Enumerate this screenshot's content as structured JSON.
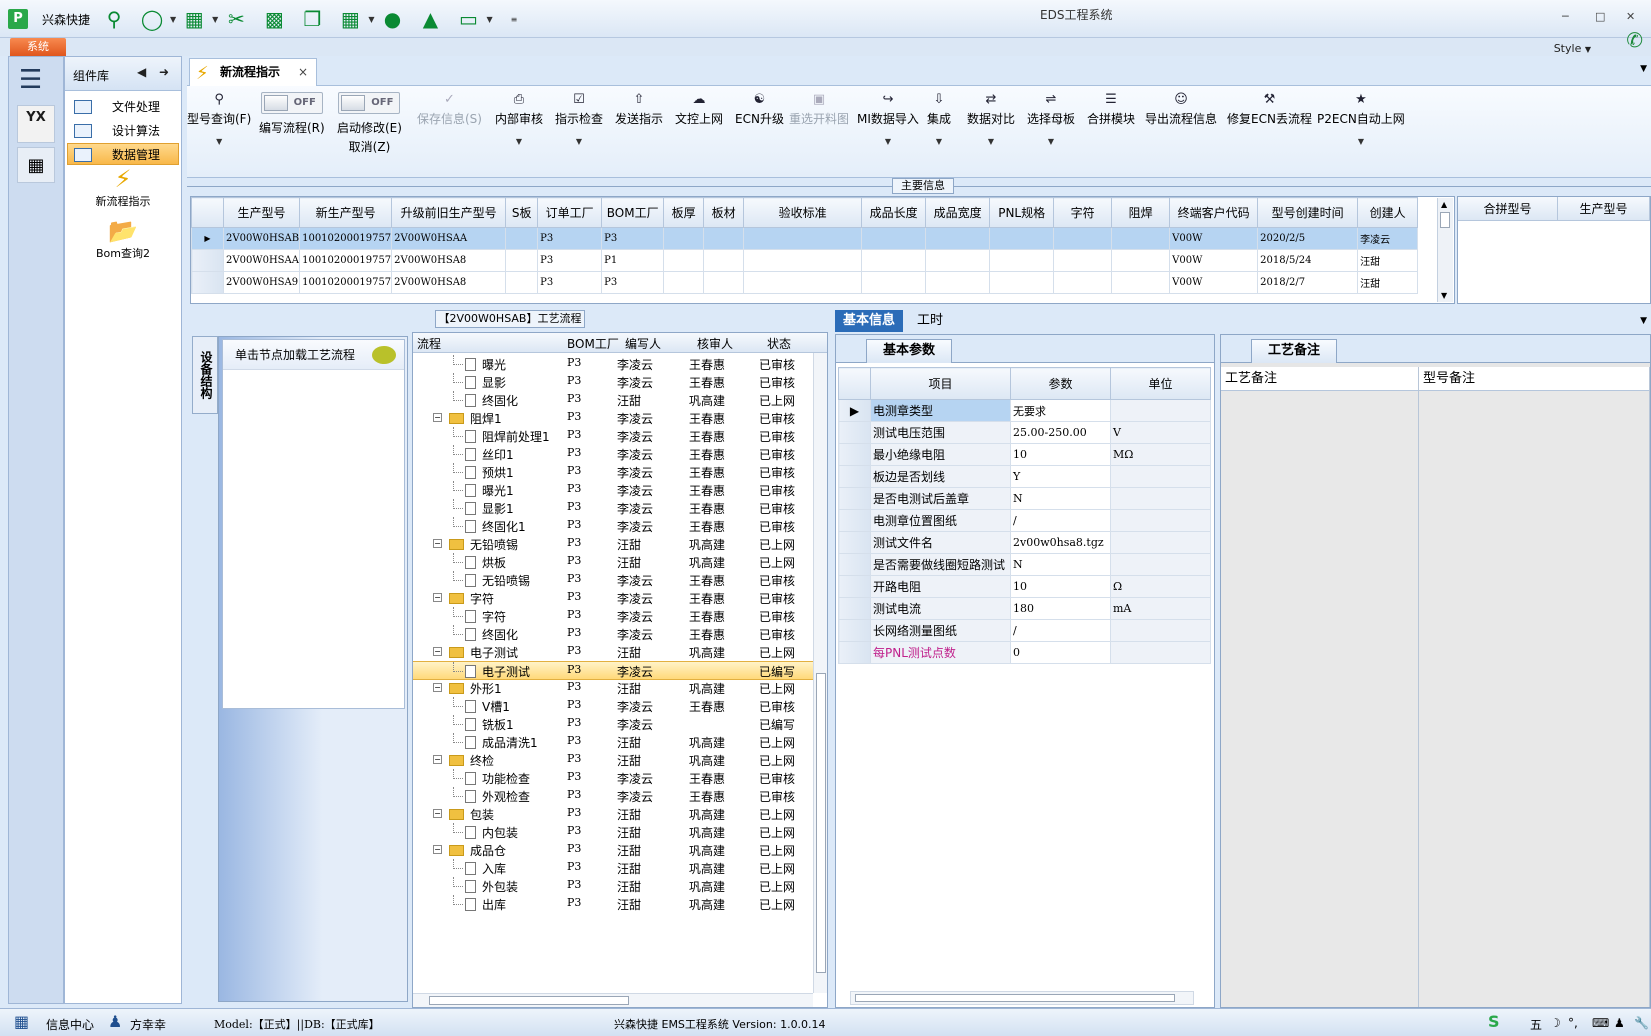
{
  "app": {
    "quick_access_label": "兴森快捷",
    "window_title": "EDS工程系统",
    "system_tab": "系统",
    "style_label": "Style"
  },
  "components": {
    "header": "组件库",
    "items": [
      {
        "label": "文件处理"
      },
      {
        "label": "设计算法"
      },
      {
        "label": "数据管理"
      }
    ],
    "big_items": [
      {
        "label": "新流程指示"
      },
      {
        "label": "Bom查询2"
      }
    ]
  },
  "doc_tab": {
    "label": "新流程指示"
  },
  "ribbon": {
    "buttons": [
      {
        "label": "型号查询(F)",
        "icon": "search-icon"
      },
      {
        "label": "编写流程(R)",
        "toggle": "OFF"
      },
      {
        "label": "启动修改(E)",
        "sub": "取消(Z)",
        "toggle": "OFF"
      },
      {
        "label": "保存信息(S)",
        "icon": "check-icon"
      },
      {
        "label": "内部审核",
        "icon": "printer-icon"
      },
      {
        "label": "指示检查",
        "icon": "checkbox-icon"
      },
      {
        "label": "发送指示",
        "icon": "upload-icon"
      },
      {
        "label": "文控上网",
        "icon": "cloud-upload-icon"
      },
      {
        "label": "ECN升级",
        "icon": "user-group-icon"
      },
      {
        "label": "重选开料图",
        "icon": "image-icon"
      },
      {
        "label": "MI数据导入",
        "icon": "import-icon"
      },
      {
        "label": "集成",
        "icon": "download-icon"
      },
      {
        "label": "数据对比",
        "icon": "compare-icon"
      },
      {
        "label": "选择母板",
        "icon": "shuffle-icon"
      },
      {
        "label": "合拼模块",
        "icon": "list-icon"
      },
      {
        "label": "导出流程信息",
        "icon": "smile-icon"
      },
      {
        "label": "修复ECN丢流程",
        "icon": "wrench-icon"
      },
      {
        "label": "P2ECN自动上网",
        "icon": "star-icon"
      }
    ]
  },
  "main_info": {
    "title": "主要信息",
    "columns": [
      "生产型号",
      "新生产型号",
      "升级前旧生产型号",
      "S板",
      "订单工厂",
      "BOM工厂",
      "板厚",
      "板材",
      "验收标准",
      "成品长度",
      "成品宽度",
      "PNL规格",
      "字符",
      "阻焊",
      "终端客户代码",
      "型号创建时间",
      "创建人"
    ],
    "rows": [
      [
        "2V00W0HSAB",
        "10010200019757",
        "2V00W0HSAA",
        "",
        "P3",
        "P3",
        "",
        "",
        "",
        "",
        "",
        "",
        "",
        "",
        "V00W",
        "2020/2/5",
        "李凌云"
      ],
      [
        "2V00W0HSAA",
        "10010200019757",
        "2V00W0HSA8",
        "",
        "P3",
        "P1",
        "",
        "",
        "",
        "",
        "",
        "",
        "",
        "",
        "V00W",
        "2018/5/24",
        "汪甜"
      ],
      [
        "2V00W0HSA9",
        "10010200019757",
        "2V00W0HSA8",
        "",
        "P3",
        "P3",
        "",
        "",
        "",
        "",
        "",
        "",
        "",
        "",
        "V00W",
        "2018/2/7",
        "汪甜"
      ]
    ],
    "side_columns": [
      "合拼型号",
      "生产型号"
    ]
  },
  "left_panel": {
    "vtab": "设备结构",
    "hint": "单击节点加载工艺流程"
  },
  "process": {
    "title": "【2V00W0HSAB】工艺流程",
    "columns": [
      "流程",
      "BOM工厂",
      "编写人",
      "核审人",
      "状态"
    ],
    "rows": [
      {
        "name": "曝光",
        "level": 2,
        "bom": "P3",
        "writer": "李凌云",
        "reviewer": "王春惠",
        "status": "已审核"
      },
      {
        "name": "显影",
        "level": 2,
        "bom": "P3",
        "writer": "李凌云",
        "reviewer": "王春惠",
        "status": "已审核"
      },
      {
        "name": "终固化",
        "level": 2,
        "bom": "P3",
        "writer": "汪甜",
        "reviewer": "巩高建",
        "status": "已上网"
      },
      {
        "name": "阻焊1",
        "level": 1,
        "bom": "P3",
        "writer": "李凌云",
        "reviewer": "王春惠",
        "status": "已审核"
      },
      {
        "name": "阻焊前处理1",
        "level": 2,
        "bom": "P3",
        "writer": "李凌云",
        "reviewer": "王春惠",
        "status": "已审核"
      },
      {
        "name": "丝印1",
        "level": 2,
        "bom": "P3",
        "writer": "李凌云",
        "reviewer": "王春惠",
        "status": "已审核"
      },
      {
        "name": "预烘1",
        "level": 2,
        "bom": "P3",
        "writer": "李凌云",
        "reviewer": "王春惠",
        "status": "已审核"
      },
      {
        "name": "曝光1",
        "level": 2,
        "bom": "P3",
        "writer": "李凌云",
        "reviewer": "王春惠",
        "status": "已审核"
      },
      {
        "name": "显影1",
        "level": 2,
        "bom": "P3",
        "writer": "李凌云",
        "reviewer": "王春惠",
        "status": "已审核"
      },
      {
        "name": "终固化1",
        "level": 2,
        "bom": "P3",
        "writer": "李凌云",
        "reviewer": "王春惠",
        "status": "已审核"
      },
      {
        "name": "无铅喷锡",
        "level": 1,
        "bom": "P3",
        "writer": "汪甜",
        "reviewer": "巩高建",
        "status": "已上网"
      },
      {
        "name": "烘板",
        "level": 2,
        "bom": "P3",
        "writer": "汪甜",
        "reviewer": "巩高建",
        "status": "已上网"
      },
      {
        "name": "无铅喷锡",
        "level": 2,
        "bom": "P3",
        "writer": "李凌云",
        "reviewer": "王春惠",
        "status": "已审核"
      },
      {
        "name": "字符",
        "level": 1,
        "bom": "P3",
        "writer": "李凌云",
        "reviewer": "王春惠",
        "status": "已审核"
      },
      {
        "name": "字符",
        "level": 2,
        "bom": "P3",
        "writer": "李凌云",
        "reviewer": "王春惠",
        "status": "已审核"
      },
      {
        "name": "终固化",
        "level": 2,
        "bom": "P3",
        "writer": "李凌云",
        "reviewer": "王春惠",
        "status": "已审核"
      },
      {
        "name": "电子测试",
        "level": 1,
        "bom": "P3",
        "writer": "汪甜",
        "reviewer": "巩高建",
        "status": "已上网"
      },
      {
        "name": "电子测试",
        "level": 2,
        "bom": "P3",
        "writer": "李凌云",
        "reviewer": "",
        "status": "已编写",
        "selected": true
      },
      {
        "name": "外形1",
        "level": 1,
        "bom": "P3",
        "writer": "汪甜",
        "reviewer": "巩高建",
        "status": "已上网"
      },
      {
        "name": "V槽1",
        "level": 2,
        "bom": "P3",
        "writer": "李凌云",
        "reviewer": "王春惠",
        "status": "已审核"
      },
      {
        "name": "铣板1",
        "level": 2,
        "bom": "P3",
        "writer": "李凌云",
        "reviewer": "",
        "status": "已编写"
      },
      {
        "name": "成品清洗1",
        "level": 2,
        "bom": "P3",
        "writer": "汪甜",
        "reviewer": "巩高建",
        "status": "已上网"
      },
      {
        "name": "终检",
        "level": 1,
        "bom": "P3",
        "writer": "汪甜",
        "reviewer": "巩高建",
        "status": "已上网"
      },
      {
        "name": "功能检查",
        "level": 2,
        "bom": "P3",
        "writer": "李凌云",
        "reviewer": "王春惠",
        "status": "已审核"
      },
      {
        "name": "外观检查",
        "level": 2,
        "bom": "P3",
        "writer": "李凌云",
        "reviewer": "王春惠",
        "status": "已审核"
      },
      {
        "name": "包装",
        "level": 1,
        "bom": "P3",
        "writer": "汪甜",
        "reviewer": "巩高建",
        "status": "已上网"
      },
      {
        "name": "内包装",
        "level": 2,
        "bom": "P3",
        "writer": "汪甜",
        "reviewer": "巩高建",
        "status": "已上网"
      },
      {
        "name": "成品仓",
        "level": 1,
        "bom": "P3",
        "writer": "汪甜",
        "reviewer": "巩高建",
        "status": "已上网"
      },
      {
        "name": "入库",
        "level": 2,
        "bom": "P3",
        "writer": "汪甜",
        "reviewer": "巩高建",
        "status": "已上网"
      },
      {
        "name": "外包装",
        "level": 2,
        "bom": "P3",
        "writer": "汪甜",
        "reviewer": "巩高建",
        "status": "已上网"
      },
      {
        "name": "出库",
        "level": 2,
        "bom": "P3",
        "writer": "汪甜",
        "reviewer": "巩高建",
        "status": "已上网"
      }
    ]
  },
  "detail": {
    "tabs": [
      "基本信息",
      "工时"
    ],
    "sub_tab": "基本参数",
    "columns": [
      "项目",
      "参数",
      "单位"
    ],
    "rows": [
      {
        "item": "电测章类型",
        "value": "无要求",
        "unit": ""
      },
      {
        "item": "测试电压范围",
        "value": "25.00-250.00",
        "unit": "V"
      },
      {
        "item": "最小绝缘电阻",
        "value": "10",
        "unit": "MΩ"
      },
      {
        "item": "板边是否划线",
        "value": "Y",
        "unit": ""
      },
      {
        "item": "是否电测试后盖章",
        "value": "N",
        "unit": ""
      },
      {
        "item": "电测章位置图纸",
        "value": "/",
        "unit": ""
      },
      {
        "item": "测试文件名",
        "value": "2v00w0hsa8.tgz",
        "unit": ""
      },
      {
        "item": "是否需要做线圈短路测试",
        "value": "N",
        "unit": ""
      },
      {
        "item": "开路电阻",
        "value": "10",
        "unit": "Ω"
      },
      {
        "item": "测试电流",
        "value": "180",
        "unit": "mA"
      },
      {
        "item": "长网络测量图纸",
        "value": "/",
        "unit": ""
      },
      {
        "item": "每PNL测试点数",
        "value": "0",
        "unit": "",
        "pink": true
      }
    ]
  },
  "remarks": {
    "tab": "工艺备注",
    "columns": [
      "工艺备注",
      "型号备注"
    ]
  },
  "status_bar": {
    "info_center": "信息中心",
    "user": "方幸幸",
    "model": "Model:【正式】||DB:【正式库】",
    "version": "兴森快捷 EMS工程系统 Version: 1.0.0.14",
    "ime": "五"
  }
}
